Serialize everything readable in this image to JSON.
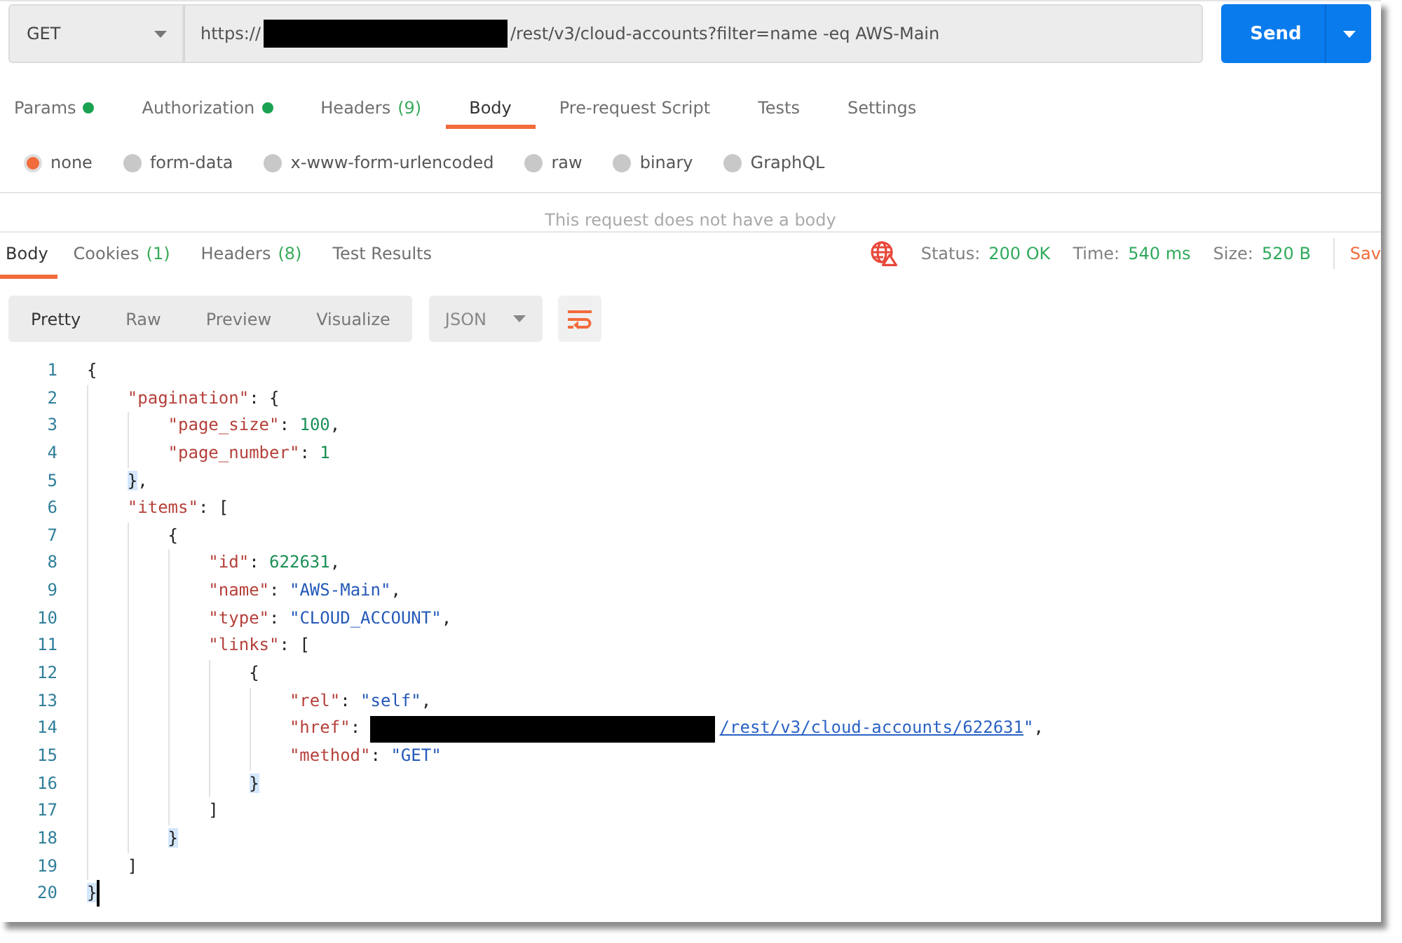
{
  "request": {
    "method": "GET",
    "url": [
      {
        "kind": "text",
        "text": "https://"
      },
      {
        "kind": "redacted"
      },
      {
        "kind": "text",
        "text": "/rest/v3/cloud-accounts?filter=name -eq AWS-Main"
      }
    ],
    "send_label": "Send"
  },
  "request_tabs": [
    {
      "label": "Params",
      "dot": true,
      "selected": false
    },
    {
      "label": "Authorization",
      "dot": true,
      "selected": false
    },
    {
      "label": "Headers",
      "count": "(9)",
      "dot": false,
      "selected": false
    },
    {
      "label": "Body",
      "dot": false,
      "selected": true
    },
    {
      "label": "Pre-request Script",
      "dot": false,
      "selected": false
    },
    {
      "label": "Tests",
      "dot": false,
      "selected": false
    },
    {
      "label": "Settings",
      "dot": false,
      "selected": false
    }
  ],
  "body_types": [
    {
      "label": "none",
      "selected": true
    },
    {
      "label": "form-data",
      "selected": false
    },
    {
      "label": "x-www-form-urlencoded",
      "selected": false
    },
    {
      "label": "raw",
      "selected": false
    },
    {
      "label": "binary",
      "selected": false
    },
    {
      "label": "GraphQL",
      "selected": false
    }
  ],
  "body_message": "This request does not have a body",
  "response_tabs": [
    {
      "label": "Body",
      "selected": true
    },
    {
      "label": "Cookies",
      "count": "(1)",
      "selected": false
    },
    {
      "label": "Headers",
      "count": "(8)",
      "selected": false
    },
    {
      "label": "Test Results",
      "selected": false
    }
  ],
  "response_stats": [
    {
      "label": "Status:",
      "value": "200 OK"
    },
    {
      "label": "Time:",
      "value": "540 ms"
    },
    {
      "label": "Size:",
      "value": "520 B"
    }
  ],
  "save_label": "Sav",
  "view_modes": [
    {
      "label": "Pretty",
      "selected": true
    },
    {
      "label": "Raw",
      "selected": false
    },
    {
      "label": "Preview",
      "selected": false
    },
    {
      "label": "Visualize",
      "selected": false
    }
  ],
  "format": "JSON",
  "editor": {
    "lines": [
      {
        "number": "1",
        "highlight": false,
        "cursor": false,
        "tokens": [
          {
            "kind": "punct",
            "text": "{"
          }
        ],
        "children": [
          {
            "number": "2",
            "highlight": false,
            "cursor": false,
            "tokens": [
              {
                "kind": "key",
                "text": "\"pagination\""
              },
              {
                "kind": "punct",
                "text": ": {"
              }
            ],
            "children": [
              {
                "number": "3",
                "highlight": false,
                "cursor": false,
                "tokens": [
                  {
                    "kind": "key",
                    "text": "\"page_size\""
                  },
                  {
                    "kind": "punct",
                    "text": ": "
                  },
                  {
                    "kind": "number",
                    "text": "100"
                  },
                  {
                    "kind": "punct",
                    "text": ","
                  }
                ]
              },
              {
                "number": "4",
                "highlight": false,
                "cursor": false,
                "tokens": [
                  {
                    "kind": "key",
                    "text": "\"page_number\""
                  },
                  {
                    "kind": "punct",
                    "text": ": "
                  },
                  {
                    "kind": "number",
                    "text": "1"
                  }
                ]
              }
            ]
          },
          {
            "number": "5",
            "highlight": true,
            "cursor": false,
            "tokens": [
              {
                "kind": "punct",
                "text": "}"
              },
              {
                "kind": "punct",
                "text": ","
              }
            ]
          },
          {
            "number": "6",
            "highlight": false,
            "cursor": false,
            "tokens": [
              {
                "kind": "key",
                "text": "\"items\""
              },
              {
                "kind": "punct",
                "text": ": ["
              }
            ],
            "children": [
              {
                "number": "7",
                "highlight": false,
                "cursor": false,
                "tokens": [
                  {
                    "kind": "punct",
                    "text": "{"
                  }
                ],
                "children": [
                  {
                    "number": "8",
                    "highlight": false,
                    "cursor": false,
                    "tokens": [
                      {
                        "kind": "key",
                        "text": "\"id\""
                      },
                      {
                        "kind": "punct",
                        "text": ": "
                      },
                      {
                        "kind": "number",
                        "text": "622631"
                      },
                      {
                        "kind": "punct",
                        "text": ","
                      }
                    ]
                  },
                  {
                    "number": "9",
                    "highlight": false,
                    "cursor": false,
                    "tokens": [
                      {
                        "kind": "key",
                        "text": "\"name\""
                      },
                      {
                        "kind": "punct",
                        "text": ": "
                      },
                      {
                        "kind": "string",
                        "text": "\"AWS-Main\""
                      },
                      {
                        "kind": "punct",
                        "text": ","
                      }
                    ]
                  },
                  {
                    "number": "10",
                    "highlight": false,
                    "cursor": false,
                    "tokens": [
                      {
                        "kind": "key",
                        "text": "\"type\""
                      },
                      {
                        "kind": "punct",
                        "text": ": "
                      },
                      {
                        "kind": "string",
                        "text": "\"CLOUD_ACCOUNT\""
                      },
                      {
                        "kind": "punct",
                        "text": ","
                      }
                    ]
                  },
                  {
                    "number": "11",
                    "highlight": false,
                    "cursor": false,
                    "tokens": [
                      {
                        "kind": "key",
                        "text": "\"links\""
                      },
                      {
                        "kind": "punct",
                        "text": ": ["
                      }
                    ],
                    "children": [
                      {
                        "number": "12",
                        "highlight": false,
                        "cursor": false,
                        "tokens": [
                          {
                            "kind": "punct",
                            "text": "{"
                          }
                        ],
                        "children": [
                          {
                            "number": "13",
                            "highlight": false,
                            "cursor": false,
                            "tokens": [
                              {
                                "kind": "key",
                                "text": "\"rel\""
                              },
                              {
                                "kind": "punct",
                                "text": ": "
                              },
                              {
                                "kind": "string",
                                "text": "\"self\""
                              },
                              {
                                "kind": "punct",
                                "text": ","
                              }
                            ]
                          },
                          {
                            "number": "14",
                            "highlight": false,
                            "cursor": false,
                            "tokens": [
                              {
                                "kind": "key",
                                "text": "\"href\""
                              },
                              {
                                "kind": "punct",
                                "text": ": "
                              },
                              {
                                "kind": "redacted"
                              },
                              {
                                "kind": "link",
                                "text": "/rest/v3/cloud-accounts/622631"
                              },
                              {
                                "kind": "string",
                                "text": "\""
                              },
                              {
                                "kind": "punct",
                                "text": ","
                              }
                            ]
                          },
                          {
                            "number": "15",
                            "highlight": false,
                            "cursor": false,
                            "tokens": [
                              {
                                "kind": "key",
                                "text": "\"method\""
                              },
                              {
                                "kind": "punct",
                                "text": ": "
                              },
                              {
                                "kind": "string",
                                "text": "\"GET\""
                              }
                            ]
                          }
                        ]
                      },
                      {
                        "number": "16",
                        "highlight": true,
                        "cursor": false,
                        "tokens": [
                          {
                            "kind": "punct",
                            "text": "}"
                          }
                        ]
                      }
                    ]
                  },
                  {
                    "number": "17",
                    "highlight": false,
                    "cursor": false,
                    "tokens": [
                      {
                        "kind": "punct",
                        "text": "]"
                      }
                    ]
                  }
                ]
              },
              {
                "number": "18",
                "highlight": true,
                "cursor": false,
                "tokens": [
                  {
                    "kind": "punct",
                    "text": "}"
                  }
                ]
              }
            ]
          },
          {
            "number": "19",
            "highlight": false,
            "cursor": false,
            "tokens": [
              {
                "kind": "punct",
                "text": "]"
              }
            ]
          }
        ]
      },
      {
        "number": "20",
        "highlight": true,
        "cursor": true,
        "tokens": [
          {
            "kind": "punct",
            "text": "}"
          }
        ]
      }
    ]
  }
}
